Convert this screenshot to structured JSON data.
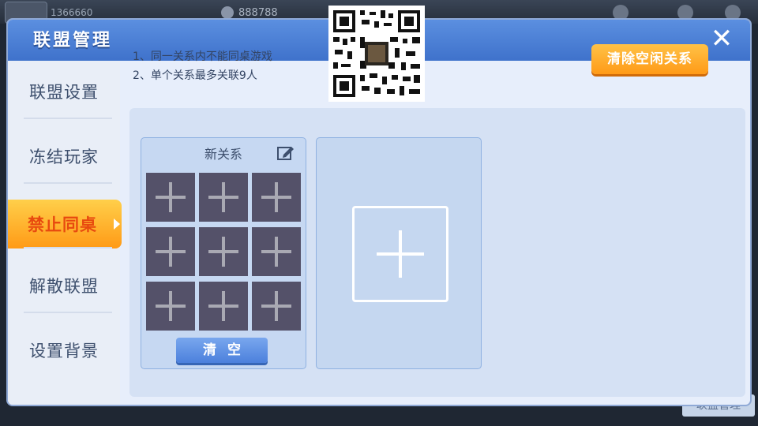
{
  "top_bar": {
    "user_id": "1366660",
    "coins": "888788"
  },
  "dialog": {
    "title": "联盟管理",
    "close_icon": "close-icon"
  },
  "sidebar": {
    "items": [
      {
        "label": "联盟设置",
        "active": false
      },
      {
        "label": "冻结玩家",
        "active": false
      },
      {
        "label": "禁止同桌",
        "active": true
      },
      {
        "label": "解散联盟",
        "active": false
      },
      {
        "label": "设置背景",
        "active": false
      }
    ]
  },
  "rules": {
    "line1": "1、同一关系内不能同桌游戏",
    "line2": "2、单个关系最多关联9人"
  },
  "actions": {
    "clear_idle_label": "清除空闲关系"
  },
  "relation_card": {
    "title": "新关系",
    "edit_icon": "edit-icon",
    "slots": 9,
    "clear_label": "清空"
  },
  "add_card": {
    "icon": "plus-icon"
  },
  "bottom": {
    "corner_label": "联盟管理"
  },
  "colors": {
    "title_blue": "#3f72cb",
    "accent_orange": "#ff9a17",
    "active_text": "#e84a0f",
    "slot_dark": "#545169"
  }
}
